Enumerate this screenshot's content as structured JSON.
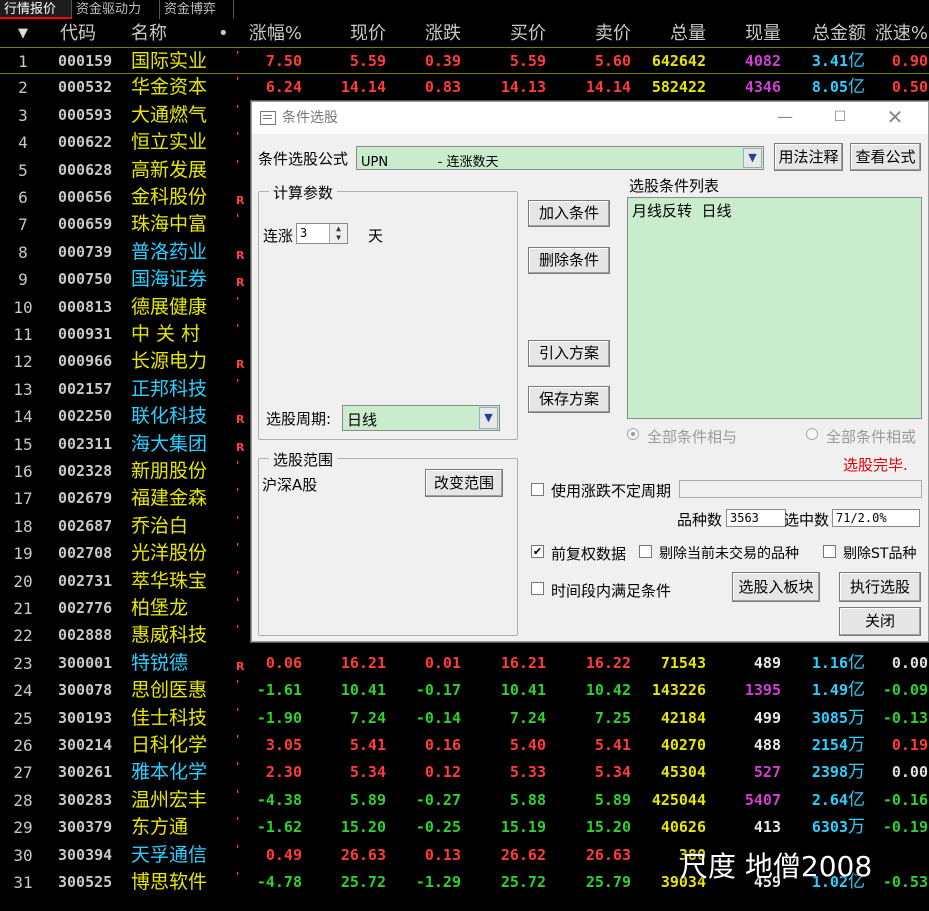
{
  "tabs": [
    "行情报价",
    "资金驱动力",
    "资金博弈"
  ],
  "header": {
    "sort_icon": "▼",
    "cols": [
      "代码",
      "名称",
      "•",
      "涨幅%",
      "现价",
      "涨跌",
      "买价",
      "卖价",
      "总量",
      "现量",
      "总金额",
      "涨速%"
    ]
  },
  "rows": [
    {
      "i": "1",
      "code": "000159",
      "name": "国际实业",
      "f": "'",
      "pct": "7.50",
      "price": "5.59",
      "chg": "0.39",
      "bid": "5.59",
      "ask": "5.60",
      "vol": "642642",
      "cur": "4082",
      "amt": "3.41",
      "unit": "亿",
      "spd": "0.90",
      "dir": "up",
      "nc": "yel",
      "cc": "mag",
      "ac": "cyan",
      "sc": "up"
    },
    {
      "i": "2",
      "code": "000532",
      "name": "华金资本",
      "f": "'",
      "pct": "6.24",
      "price": "14.14",
      "chg": "0.83",
      "bid": "14.13",
      "ask": "14.14",
      "vol": "582422",
      "cur": "4346",
      "amt": "8.05",
      "unit": "亿",
      "spd": "0.50",
      "dir": "up",
      "nc": "yel",
      "cc": "mag",
      "ac": "cyan",
      "sc": "up"
    },
    {
      "i": "3",
      "code": "000593",
      "name": "大通燃气",
      "f": "'",
      "nc": "yel"
    },
    {
      "i": "4",
      "code": "000622",
      "name": "恒立实业",
      "f": "'",
      "nc": "yel"
    },
    {
      "i": "5",
      "code": "000628",
      "name": "高新发展",
      "f": "'",
      "nc": "yel"
    },
    {
      "i": "6",
      "code": "000656",
      "name": "金科股份",
      "f": "R",
      "nc": "yel"
    },
    {
      "i": "7",
      "code": "000659",
      "name": "珠海中富",
      "f": "'",
      "nc": "yel"
    },
    {
      "i": "8",
      "code": "000739",
      "name": "普洛药业",
      "f": "R",
      "nc": "cyan"
    },
    {
      "i": "9",
      "code": "000750",
      "name": "国海证券",
      "f": "R",
      "nc": "cyan"
    },
    {
      "i": "10",
      "code": "000813",
      "name": "德展健康",
      "f": "'",
      "nc": "yel"
    },
    {
      "i": "11",
      "code": "000931",
      "name": "中 关 村",
      "f": "'",
      "nc": "yel"
    },
    {
      "i": "12",
      "code": "000966",
      "name": "长源电力",
      "f": "R",
      "nc": "yel"
    },
    {
      "i": "13",
      "code": "002157",
      "name": "正邦科技",
      "f": "'",
      "nc": "cyan"
    },
    {
      "i": "14",
      "code": "002250",
      "name": "联化科技",
      "f": "R",
      "nc": "cyan"
    },
    {
      "i": "15",
      "code": "002311",
      "name": "海大集团",
      "f": "R",
      "nc": "cyan"
    },
    {
      "i": "16",
      "code": "002328",
      "name": "新朋股份",
      "f": "'",
      "nc": "yel"
    },
    {
      "i": "17",
      "code": "002679",
      "name": "福建金森",
      "f": "'",
      "nc": "yel"
    },
    {
      "i": "18",
      "code": "002687",
      "name": "乔治白",
      "f": "'",
      "nc": "yel"
    },
    {
      "i": "19",
      "code": "002708",
      "name": "光洋股份",
      "f": "'",
      "nc": "yel"
    },
    {
      "i": "20",
      "code": "002731",
      "name": "萃华珠宝",
      "f": "'",
      "nc": "yel"
    },
    {
      "i": "21",
      "code": "002776",
      "name": "柏堡龙",
      "f": "'",
      "nc": "yel"
    },
    {
      "i": "22",
      "code": "002888",
      "name": "惠威科技",
      "f": "'",
      "nc": "yel"
    },
    {
      "i": "23",
      "code": "300001",
      "name": "特锐德",
      "f": "R",
      "pct": "0.06",
      "price": "16.21",
      "chg": "0.01",
      "bid": "16.21",
      "ask": "16.22",
      "vol": "71543",
      "cur": "489",
      "amt": "1.16",
      "unit": "亿",
      "spd": "0.00",
      "dir": "up",
      "nc": "cyan",
      "cc": "wh",
      "ac": "cyan",
      "sc": "flat"
    },
    {
      "i": "24",
      "code": "300078",
      "name": "思创医惠",
      "f": "'",
      "pct": "-1.61",
      "price": "10.41",
      "chg": "-0.17",
      "bid": "10.41",
      "ask": "10.42",
      "vol": "143226",
      "cur": "1395",
      "amt": "1.49",
      "unit": "亿",
      "spd": "-0.09",
      "dir": "dn",
      "nc": "yel",
      "cc": "mag",
      "ac": "cyan",
      "sc": "dn"
    },
    {
      "i": "25",
      "code": "300193",
      "name": "佳士科技",
      "f": "'",
      "pct": "-1.90",
      "price": "7.24",
      "chg": "-0.14",
      "bid": "7.24",
      "ask": "7.25",
      "vol": "42184",
      "cur": "499",
      "amt": "3085",
      "unit": "万",
      "spd": "-0.13",
      "dir": "dn",
      "nc": "yel",
      "cc": "wh",
      "ac": "cyan",
      "sc": "dn"
    },
    {
      "i": "26",
      "code": "300214",
      "name": "日科化学",
      "f": "'",
      "pct": "3.05",
      "price": "5.41",
      "chg": "0.16",
      "bid": "5.40",
      "ask": "5.41",
      "vol": "40270",
      "cur": "488",
      "amt": "2154",
      "unit": "万",
      "spd": "0.19",
      "dir": "up",
      "nc": "yel",
      "cc": "wh",
      "ac": "cyan",
      "sc": "up"
    },
    {
      "i": "27",
      "code": "300261",
      "name": "雅本化学",
      "f": "'",
      "pct": "2.30",
      "price": "5.34",
      "chg": "0.12",
      "bid": "5.33",
      "ask": "5.34",
      "vol": "45304",
      "cur": "527",
      "amt": "2398",
      "unit": "万",
      "spd": "0.00",
      "dir": "up",
      "nc": "cyan",
      "cc": "mag",
      "ac": "cyan",
      "sc": "flat"
    },
    {
      "i": "28",
      "code": "300283",
      "name": "温州宏丰",
      "f": "'",
      "pct": "-4.38",
      "price": "5.89",
      "chg": "-0.27",
      "bid": "5.88",
      "ask": "5.89",
      "vol": "425044",
      "cur": "5407",
      "amt": "2.64",
      "unit": "亿",
      "spd": "-0.16",
      "dir": "dn",
      "nc": "yel",
      "cc": "mag",
      "ac": "cyan",
      "sc": "dn"
    },
    {
      "i": "29",
      "code": "300379",
      "name": "东方通",
      "f": "'",
      "pct": "-1.62",
      "price": "15.20",
      "chg": "-0.25",
      "bid": "15.19",
      "ask": "15.20",
      "vol": "40626",
      "cur": "413",
      "amt": "6303",
      "unit": "万",
      "spd": "-0.19",
      "dir": "dn",
      "nc": "yel",
      "cc": "wh",
      "ac": "cyan",
      "sc": "dn"
    },
    {
      "i": "30",
      "code": "300394",
      "name": "天孚通信",
      "f": "'",
      "pct": "0.49",
      "price": "26.63",
      "chg": "0.13",
      "bid": "26.62",
      "ask": "26.63",
      "vol": "380",
      "cur": "",
      "amt": "",
      "unit": "",
      "spd": "",
      "dir": "up",
      "nc": "cyan",
      "cc": "wh",
      "ac": "cyan",
      "sc": "up"
    },
    {
      "i": "31",
      "code": "300525",
      "name": "博思软件",
      "f": "'",
      "pct": "-4.78",
      "price": "25.72",
      "chg": "-1.29",
      "bid": "25.72",
      "ask": "25.79",
      "vol": "39034",
      "cur": "459",
      "amt": "1.02",
      "unit": "亿",
      "spd": "-0.53",
      "dir": "dn",
      "nc": "yel",
      "cc": "wh",
      "ac": "cyan",
      "sc": "dn"
    }
  ],
  "dialog": {
    "title": "条件选股",
    "formula_label": "条件选股公式",
    "formula_value": "UPN            - 连涨数天",
    "btn_usage": "用法注释",
    "btn_view": "查看公式",
    "calc_group": "计算参数",
    "lianzhang_label": "连涨",
    "lianzhang_value": "3",
    "day_label": "天",
    "period_label": "选股周期:",
    "period_value": "日线",
    "btn_add": "加入条件",
    "btn_delete": "删除条件",
    "btn_import": "引入方案",
    "btn_save": "保存方案",
    "list_label": "选股条件列表",
    "list_items": [
      "月线反转  日线"
    ],
    "radio_and": "全部条件相与",
    "radio_or": "全部条件相或",
    "status": "选股完毕.",
    "range_group": "选股范围",
    "range_value": "沪深A股",
    "btn_change_range": "改变范围",
    "chk_irregular": "使用涨跌不定周期",
    "count_label": "品种数",
    "count_value": "3563",
    "selected_label": "选中数",
    "selected_value": "71/2.0%",
    "chk_adjust": "前复权数据",
    "chk_exclude_untraded": "剔除当前未交易的品种",
    "chk_exclude_st": "剔除ST品种",
    "chk_time_range": "时间段内满足条件",
    "btn_to_block": "选股入板块",
    "btn_execute": "执行选股",
    "btn_close": "关闭"
  },
  "watermark": "尺度  地僧2008"
}
